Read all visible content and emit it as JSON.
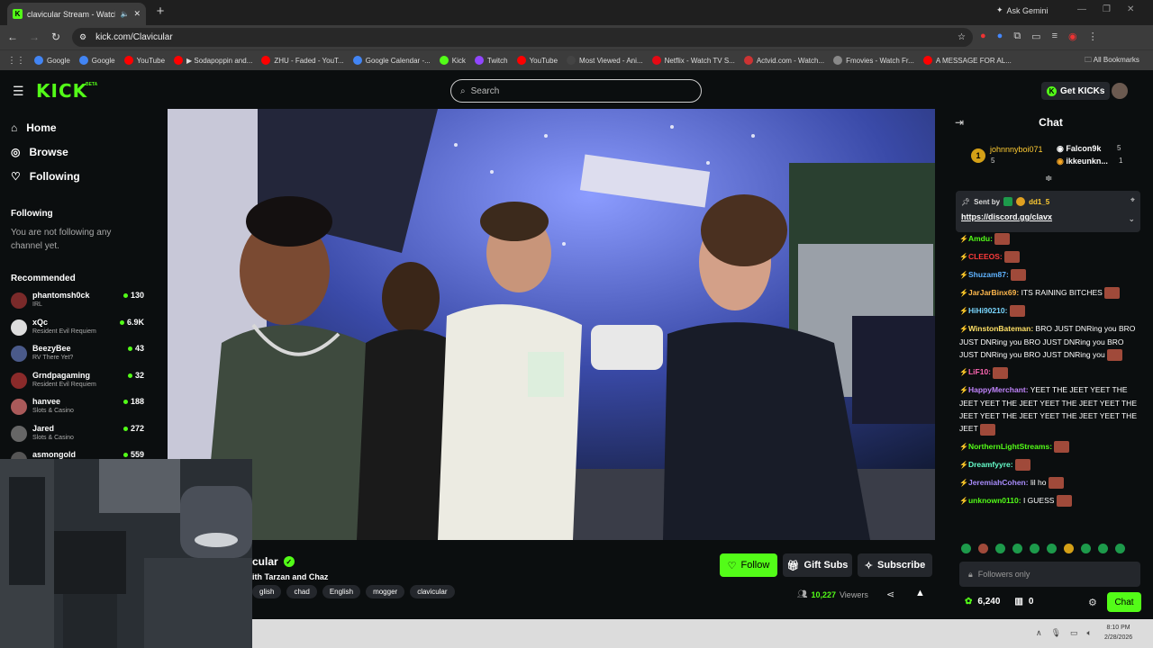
{
  "browser": {
    "tab_title": "clavicular Stream - Watch L",
    "url": "kick.com/Clavicular",
    "ask_gemini": "Ask Gemini",
    "bookmarks": [
      {
        "label": "Google",
        "color": "#4285f4"
      },
      {
        "label": "Google",
        "color": "#4285f4"
      },
      {
        "label": "YouTube",
        "color": "#ff0000"
      },
      {
        "label": "▶ Sodapoppin and...",
        "color": "#ff0000"
      },
      {
        "label": "ZHU - Faded - YouT...",
        "color": "#ff0000"
      },
      {
        "label": "Google Calendar -...",
        "color": "#4285f4"
      },
      {
        "label": "Kick",
        "color": "#53fc18"
      },
      {
        "label": "Twitch",
        "color": "#9146ff"
      },
      {
        "label": "YouTube",
        "color": "#ff0000"
      },
      {
        "label": "Most Viewed - Ani...",
        "color": "#444444"
      },
      {
        "label": "Netflix - Watch TV S...",
        "color": "#e50914"
      },
      {
        "label": "Actvid.com - Watch...",
        "color": "#cc3333"
      },
      {
        "label": "Fmovies - Watch Fr...",
        "color": "#888888"
      },
      {
        "label": "A MESSAGE FOR AL...",
        "color": "#ff0000"
      }
    ],
    "all_bookmarks": "All Bookmarks"
  },
  "header": {
    "logo": "KICK",
    "beta": "BETA",
    "search_placeholder": "Search",
    "get_kicks": "Get KICKs"
  },
  "sidebar": {
    "nav": [
      {
        "label": "Home",
        "icon": "home-icon"
      },
      {
        "label": "Browse",
        "icon": "compass-icon"
      },
      {
        "label": "Following",
        "icon": "heart-icon"
      }
    ],
    "following_header": "Following",
    "no_follow_text": "You are not following any channel yet.",
    "recommended_header": "Recommended",
    "recommended": [
      {
        "name": "phantomsh0ck",
        "category": "IRL",
        "viewers": "130",
        "color": "#7a2a2a"
      },
      {
        "name": "xQc",
        "category": "Resident Evil Requiem",
        "viewers": "6.9K",
        "color": "#dddddd"
      },
      {
        "name": "BeezyBee",
        "category": "RV There Yet?",
        "viewers": "43",
        "color": "#4a5a8a"
      },
      {
        "name": "Grndpagaming",
        "category": "Resident Evil Requiem",
        "viewers": "32",
        "color": "#8a2a2a"
      },
      {
        "name": "hanvee",
        "category": "Slots & Casino",
        "viewers": "188",
        "color": "#aa5a5a"
      },
      {
        "name": "Jared",
        "category": "Slots & Casino",
        "viewers": "272",
        "color": "#666666"
      },
      {
        "name": "asmongold",
        "category": "",
        "viewers": "559",
        "color": "#555555"
      }
    ]
  },
  "stream": {
    "channel_name": "cular",
    "title": "ith Tarzan and Chaz",
    "tags": [
      "glish",
      "chad",
      "English",
      "mogger",
      "clavicular"
    ],
    "follow_label": "Follow",
    "gift_label": "Gift Subs",
    "subscribe_label": "Subscribe",
    "viewer_count": "10,227",
    "viewers_word": "Viewers"
  },
  "chat": {
    "title": "Chat",
    "leaderboard": {
      "rank1_name": "johnnnyboi071",
      "rank1_count": "5",
      "rank2_name": "Falcon9k",
      "rank2_count": "5",
      "rank3_name": "ikkeunkn...",
      "rank3_count": "1"
    },
    "pinned": {
      "sent_by_label": "Sent by",
      "sender": "dd1_5",
      "link": "https://discord.gg/clavx"
    },
    "messages": [
      {
        "user": "Amdu",
        "color": "#53fc18",
        "text": ""
      },
      {
        "user": "CLEEOS",
        "color": "#ff3b3b",
        "text": ""
      },
      {
        "user": "Shuzam87",
        "color": "#5fb3ff",
        "text": ""
      },
      {
        "user": "JarJarBinx69",
        "color": "#ffb84d",
        "text": "ITS RAINING BITCHES"
      },
      {
        "user": "HiHi90210",
        "color": "#7ad7ff",
        "text": ""
      },
      {
        "user": "WinstonBateman",
        "color": "#ffe066",
        "text": "BRO JUST DNRing you BRO JUST DNRing you BRO JUST DNRing you BRO JUST DNRing you BRO JUST DNRing you"
      },
      {
        "user": "LiF10",
        "color": "#ff66b3",
        "text": ""
      },
      {
        "user": "HappyMerchant",
        "color": "#c084fc",
        "text": "YEET THE JEET YEET THE JEET YEET THE JEET YEET THE JEET YEET THE JEET YEET THE JEET YEET THE JEET YEET THE JEET"
      },
      {
        "user": "NorthernLightStreams",
        "color": "#53fc18",
        "text": ""
      },
      {
        "user": "Dreamfyyre",
        "color": "#66ffcc",
        "text": ""
      },
      {
        "user": "JeremiahCohen",
        "color": "#a78bfa",
        "text": "lil ho"
      },
      {
        "user": "unknown0110",
        "color": "#53fc18",
        "text": "I GUESS"
      }
    ],
    "input_placeholder": "Followers only",
    "kicks_balance": "6,240",
    "gift_count": "0",
    "send_label": "Chat"
  },
  "taskbar": {
    "time": "8:10 PM",
    "date": "2/28/2026"
  }
}
